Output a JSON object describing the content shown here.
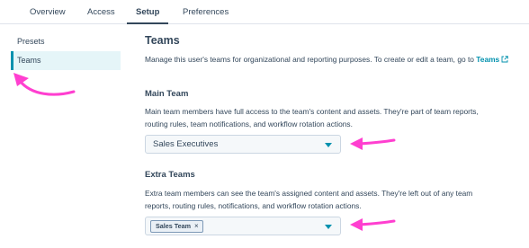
{
  "tabs": [
    {
      "label": "Overview"
    },
    {
      "label": "Access"
    },
    {
      "label": "Setup",
      "active": true
    },
    {
      "label": "Preferences"
    }
  ],
  "sidebar": {
    "items": [
      {
        "label": "Presets"
      },
      {
        "label": "Teams",
        "active": true
      }
    ]
  },
  "main": {
    "title": "Teams",
    "description": "Manage this user's teams for organizational and reporting purposes. To create or edit a team, go to",
    "link_label": "Teams",
    "link_icon": "external-link-icon",
    "main_team": {
      "heading": "Main Team",
      "desc_line1": "Main team members have full access to the team's content and assets. They're part of team reports,",
      "desc_line2": "routing rules, team notifications, and workflow rotation actions.",
      "selected": "Sales Executives"
    },
    "extra_teams": {
      "heading": "Extra Teams",
      "desc_line1": "Extra team members can see the team's assigned content and assets. They're left out of any team",
      "desc_line2": "reports, routing rules, notifications, and workflow rotation actions.",
      "tag_label": "Sales Team",
      "tag_remove": "×"
    }
  },
  "colors": {
    "accent": "#0091ae",
    "text": "#33475b",
    "annotation": "#ff3fd0"
  }
}
